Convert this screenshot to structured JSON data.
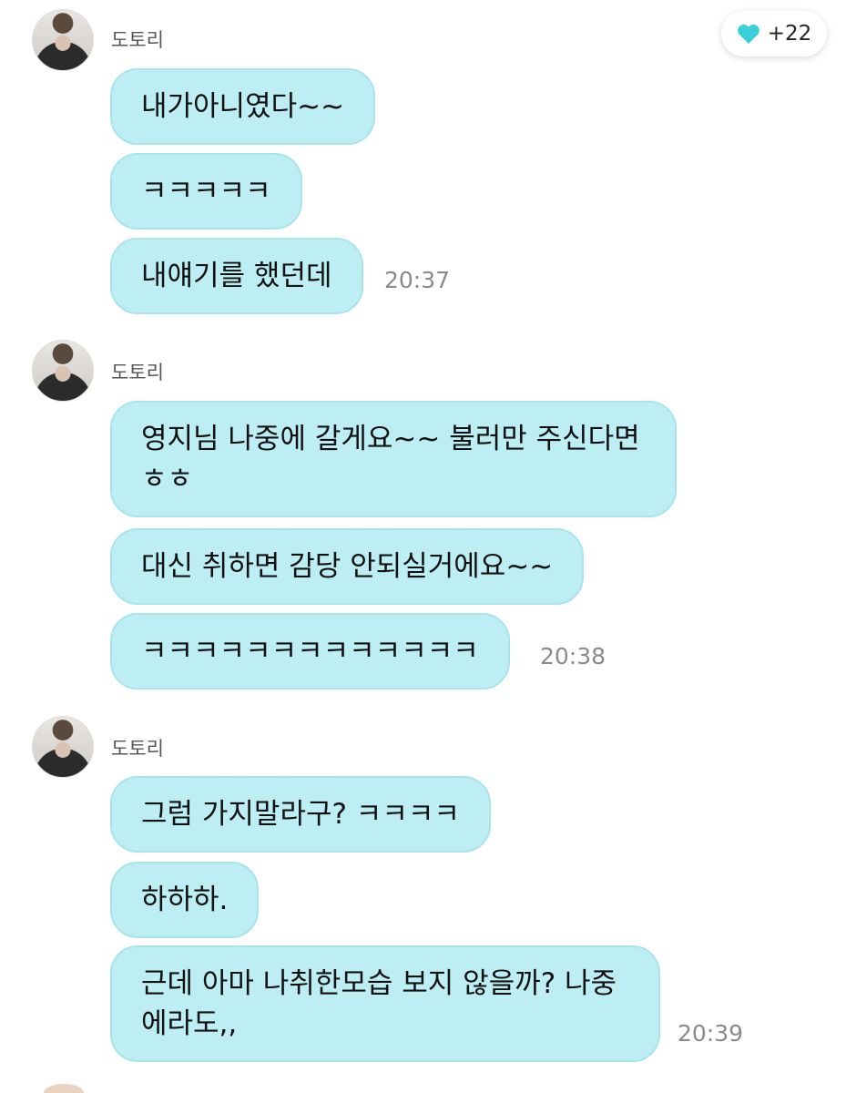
{
  "reaction": {
    "icon": "heart-icon",
    "count": "+22",
    "color": "#3ad0d9"
  },
  "groups": [
    {
      "sender": "도토리",
      "messages": [
        "내가아니였다~~",
        "ㅋㅋㅋㅋㅋ",
        "내얘기를 했던데"
      ],
      "time": "20:37"
    },
    {
      "sender": "도토리",
      "messages": [
        "영지님 나중에 갈게요~~ 불러만 주신다면 ㅎㅎ",
        "대신 취하면 감당 안되실거에요~~",
        "ㅋㅋㅋㅋㅋㅋㅋㅋㅋㅋㅋㅋㅋ"
      ],
      "time": "20:38"
    },
    {
      "sender": "도토리",
      "messages": [
        "그럼 가지말라구? ㅋㅋㅋㅋ",
        "하하하.",
        "근데 아마 나취한모습 보지 않을까? 나중에라도,,"
      ],
      "time": "20:39"
    }
  ],
  "colors": {
    "bubble": "#bdeef4",
    "bubble_border": "#a9e3ec",
    "time": "#8a8a8a"
  }
}
